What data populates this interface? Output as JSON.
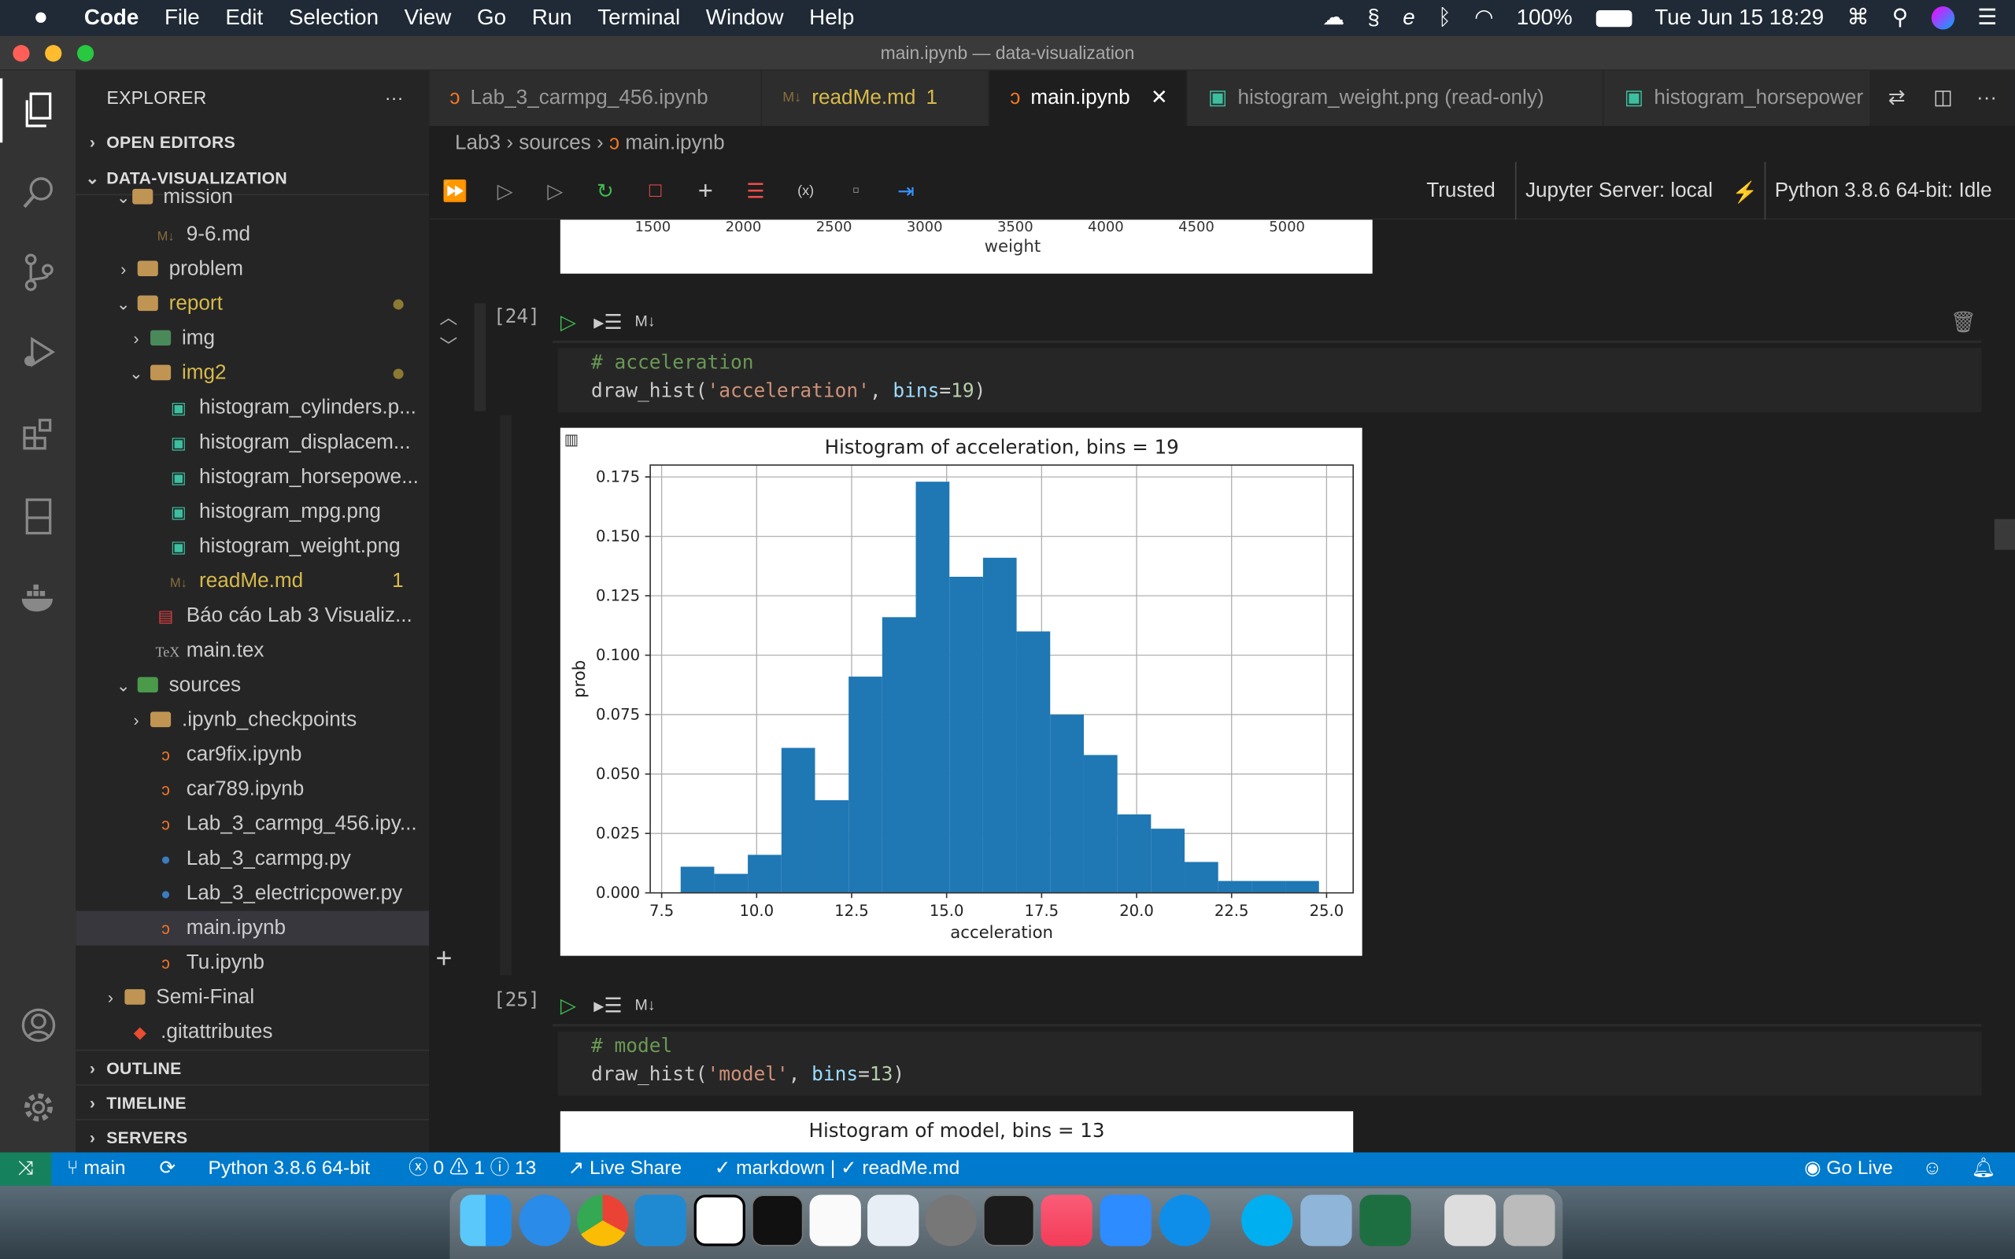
{
  "menubar": {
    "app": "Code",
    "items": [
      "File",
      "Edit",
      "Selection",
      "View",
      "Go",
      "Run",
      "Terminal",
      "Window",
      "Help"
    ],
    "battery": "100%",
    "clock": "Tue Jun 15  18:29"
  },
  "window": {
    "title": "main.ipynb — data-visualization"
  },
  "sidebar": {
    "title": "EXPLORER",
    "open_editors": "OPEN EDITORS",
    "project": "DATA-VISUALIZATION",
    "items": [
      {
        "label": "mission",
        "type": "folder-open"
      },
      {
        "label": "9-6.md",
        "type": "md"
      },
      {
        "label": "problem",
        "type": "folder"
      },
      {
        "label": "report",
        "type": "folder-open"
      },
      {
        "label": "img",
        "type": "img-folder"
      },
      {
        "label": "img2",
        "type": "folder-open"
      },
      {
        "label": "histogram_cylinders.p...",
        "type": "image"
      },
      {
        "label": "histogram_displacem...",
        "type": "image"
      },
      {
        "label": "histogram_horsepowe...",
        "type": "image"
      },
      {
        "label": "histogram_mpg.png",
        "type": "image"
      },
      {
        "label": "histogram_weight.png",
        "type": "image"
      },
      {
        "label": "readMe.md",
        "type": "md",
        "badge": "1"
      },
      {
        "label": "Báo cáo Lab 3 Visualiz...",
        "type": "pdf"
      },
      {
        "label": "main.tex",
        "type": "tex"
      },
      {
        "label": "sources",
        "type": "folder-open"
      },
      {
        "label": ".ipynb_checkpoints",
        "type": "folder"
      },
      {
        "label": "car9fix.ipynb",
        "type": "nb"
      },
      {
        "label": "car789.ipynb",
        "type": "nb"
      },
      {
        "label": "Lab_3_carmpg_456.ipy...",
        "type": "nb"
      },
      {
        "label": "Lab_3_carmpg.py",
        "type": "py"
      },
      {
        "label": "Lab_3_electricpower.py",
        "type": "py"
      },
      {
        "label": "main.ipynb",
        "type": "nb"
      },
      {
        "label": "Tu.ipynb",
        "type": "nb"
      },
      {
        "label": "Semi-Final",
        "type": "folder"
      },
      {
        "label": ".gitattributes",
        "type": "git"
      }
    ],
    "sections": [
      "OUTLINE",
      "TIMELINE",
      "SERVERS"
    ]
  },
  "tabs": [
    {
      "label": "Lab_3_carmpg_456.ipynb"
    },
    {
      "label": "readMe.md",
      "badge": "1"
    },
    {
      "label": "main.ipynb",
      "active": true
    },
    {
      "label": "histogram_weight.png (read-only)"
    },
    {
      "label": "histogram_horsepower"
    }
  ],
  "breadcrumb": {
    "a": "Lab3",
    "b": "sources",
    "c": "main.ipynb"
  },
  "nbtoolbar": {
    "trusted": "Trusted",
    "server": "Jupyter Server: local",
    "kernel": "Python 3.8.6 64-bit: Idle"
  },
  "cells": [
    {
      "num": "[24]",
      "md_toggle": "M↓",
      "comment": "# acceleration",
      "fn": "draw_hist(",
      "arg": "'acceleration'",
      "kw": "bins",
      "val": "19"
    },
    {
      "num": "[25]",
      "md_toggle": "M↓",
      "comment": "# model",
      "fn": "draw_hist(",
      "arg": "'model'",
      "kw": "bins",
      "val": "13"
    }
  ],
  "prev_output": {
    "xlabel": "weight",
    "ticks": [
      "1500",
      "2000",
      "2500",
      "3000",
      "3500",
      "4000",
      "4500",
      "5000"
    ]
  },
  "chart_data": {
    "type": "bar",
    "title": "Histogram of acceleration, bins = 19",
    "xlabel": "acceleration",
    "ylabel": "prob",
    "xlim": [
      7.2,
      25.7
    ],
    "ylim": [
      0,
      0.18
    ],
    "xticks": [
      "7.5",
      "10.0",
      "12.5",
      "15.0",
      "17.5",
      "20.0",
      "22.5",
      "25.0"
    ],
    "yticks": [
      "0.000",
      "0.025",
      "0.050",
      "0.075",
      "0.100",
      "0.125",
      "0.150",
      "0.175"
    ],
    "bin_edges": [
      8.0,
      8.884,
      9.768,
      10.653,
      11.537,
      12.421,
      13.305,
      14.189,
      15.074,
      15.958,
      16.842,
      17.726,
      18.611,
      19.495,
      20.379,
      21.263,
      22.147,
      23.032,
      23.916,
      24.8
    ],
    "values": [
      0.011,
      0.008,
      0.016,
      0.061,
      0.039,
      0.091,
      0.116,
      0.173,
      0.133,
      0.141,
      0.11,
      0.075,
      0.058,
      0.033,
      0.027,
      0.013,
      0.005,
      0.005,
      0.005
    ],
    "color": "#1f77b4",
    "grid": true
  },
  "next_output": {
    "title": "Histogram of model, bins = 13"
  },
  "status": {
    "branch": "main",
    "python": "Python 3.8.6 64-bit",
    "errors": "0",
    "warnings": "1",
    "infos": "13",
    "liveshare": "Live Share",
    "lang": "✓ markdown | ✓ readMe.md",
    "golive": "Go Live"
  },
  "colors": {
    "accent": "#007acc",
    "folder": "#c09553",
    "modified": "#d7ba4a"
  }
}
